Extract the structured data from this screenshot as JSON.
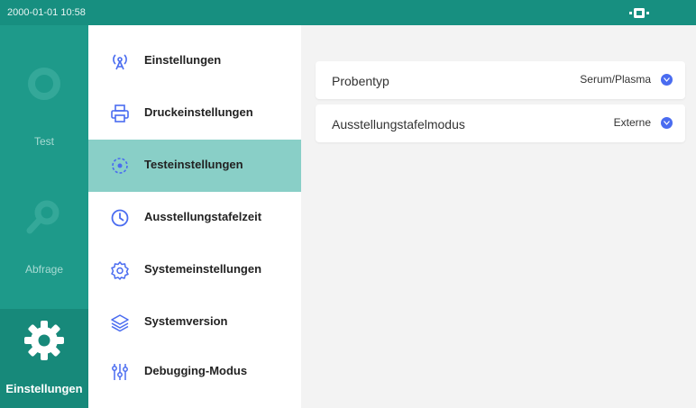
{
  "status_bar": {
    "datetime": "2000-01-01 10:58",
    "status_icon": "device-status-icon"
  },
  "nav": {
    "items": [
      {
        "label": "Test",
        "icon": "test-icon",
        "active": false
      },
      {
        "label": "Abfrage",
        "icon": "query-icon",
        "active": false
      },
      {
        "label": "Einstellungen",
        "icon": "gear-icon",
        "active": true
      }
    ]
  },
  "menu": {
    "items": [
      {
        "label": "Einstellungen",
        "icon": "antenna-icon",
        "active": false
      },
      {
        "label": "Druckeinstellungen",
        "icon": "printer-icon",
        "active": false
      },
      {
        "label": "Testeinstellungen",
        "icon": "target-icon",
        "active": true
      },
      {
        "label": "Ausstellungstafelzeit",
        "icon": "clock-icon",
        "active": false
      },
      {
        "label": "Systemeinstellungen",
        "icon": "gear-outline-icon",
        "active": false
      },
      {
        "label": "Systemversion",
        "icon": "layers-icon",
        "active": false
      },
      {
        "label": "Debugging-Modus",
        "icon": "sliders-icon",
        "active": false
      }
    ]
  },
  "settings": {
    "rows": [
      {
        "label": "Probentyp",
        "value": "Serum/Plasma"
      },
      {
        "label": "Ausstellungstafelmodus",
        "value": "Externe"
      }
    ]
  },
  "colors": {
    "accent": "#1e9a8a",
    "statusbar": "#178f80",
    "menu_active": "#89cfc7",
    "dropdown_dot": "#4a6cf0"
  }
}
